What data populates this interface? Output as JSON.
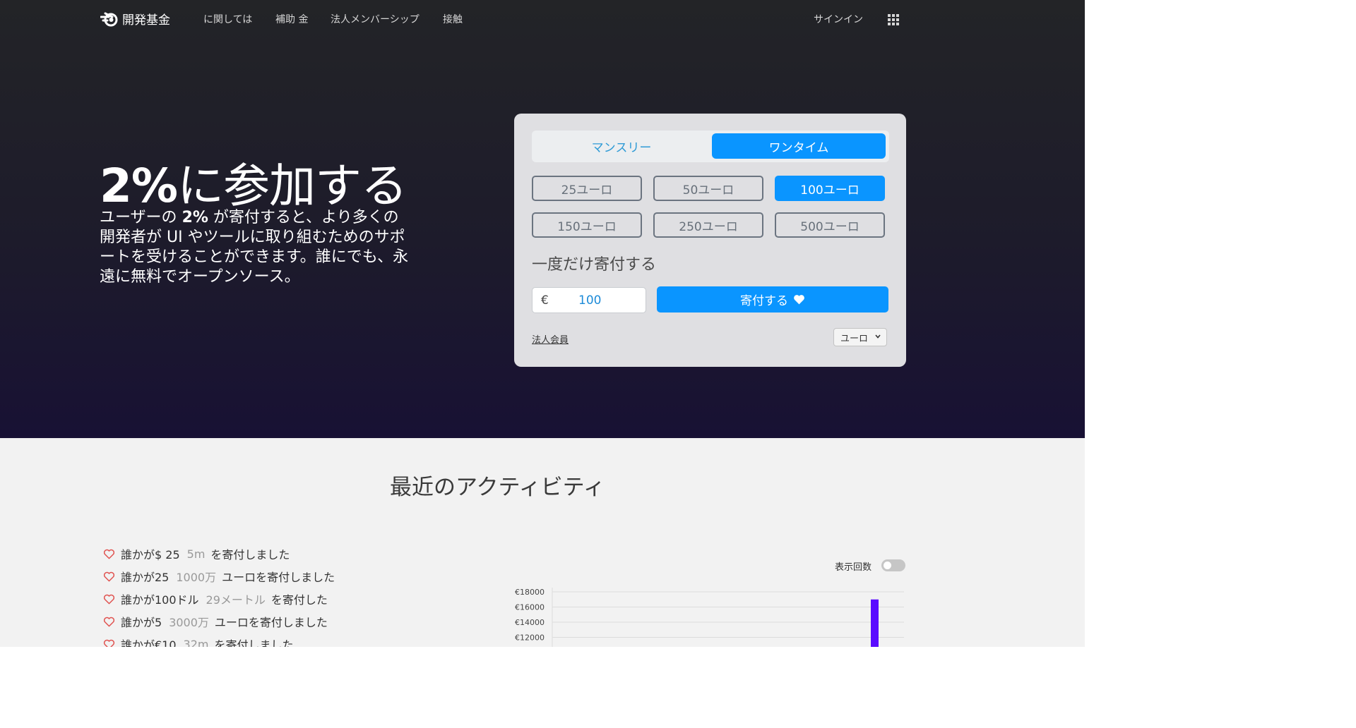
{
  "nav": {
    "brand": "開発基金",
    "links": [
      "に関しては",
      "補助 金",
      "法人メンバーシップ",
      "接触"
    ],
    "signin": "サインイン",
    "apps_icon": "grid-icon"
  },
  "hero": {
    "title_bold": "2%",
    "title_rest": "に参加する",
    "desc_1": "ユーザーの ",
    "desc_bold": "2%",
    "desc_2": " が寄付すると、より多くの開発者が UI やツールに取り組むためのサポートを受けることができます。誰にでも、永遠に無料でオープンソース。"
  },
  "donation": {
    "tab_monthly": "マンスリー",
    "tab_onetime": "ワンタイム",
    "active_tab": "ワンタイム",
    "amounts": [
      "25ユーロ",
      "50ユーロ",
      "100ユーロ",
      "150ユーロ",
      "250ユーロ",
      "500ユーロ"
    ],
    "selected_amount": "100ユーロ",
    "frequency_label": "一度だけ寄付する",
    "currency_symbol": "€",
    "amount_value": "100",
    "donate_label": "寄付する",
    "corporate_link": "法人会員",
    "currency_select": "ユーロ"
  },
  "activity": {
    "title": "最近のアクティビティ",
    "items": [
      {
        "pre": "誰かが$ 25",
        "time": "5m",
        "post": "を寄付しました"
      },
      {
        "pre": "誰かが25",
        "time": "1000万",
        "post": "ユーロを寄付しました"
      },
      {
        "pre": "誰かが100ドル",
        "time": "29メートル",
        "post": "を寄付した"
      },
      {
        "pre": "誰かが5",
        "time": "3000万",
        "post": "ユーロを寄付しました"
      },
      {
        "pre": "誰かが€10",
        "time": "32m",
        "post": "を寄付しました"
      }
    ],
    "toggle_label": "表示回数",
    "toggle_on": false
  },
  "colors": {
    "accent": "#0a95ff",
    "bar": "#5a0cff",
    "heart": "#e0524f"
  },
  "chart_data": {
    "type": "bar",
    "y_ticks": [
      "€18000",
      "€16000",
      "€14000",
      "€12000"
    ],
    "ylim": [
      12000,
      18000
    ],
    "values": [
      {
        "label": "",
        "value": 17000
      }
    ]
  }
}
